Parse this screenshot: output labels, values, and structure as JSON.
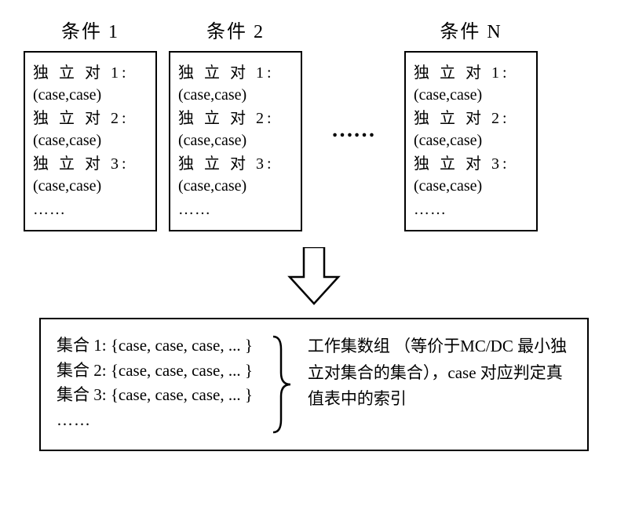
{
  "headers": {
    "condition1": "条件 1",
    "condition2": "条件 2",
    "conditionN": "条件 N"
  },
  "box_content": {
    "pair1_label": "独 立 对  1:",
    "pair1_value": "(case,case)",
    "pair2_label": "独 立 对  2:",
    "pair2_value": "(case,case)",
    "pair3_label": "独 立 对  3:",
    "pair3_value": "(case,case)",
    "ellipsis": "……"
  },
  "horizontal_ellipsis": "……",
  "bottom": {
    "set1": "集合 1: {case, case, case, ... }",
    "set2": "集合 2: {case, case, case, ... }",
    "set3": "集合 3: {case, case, case, ... }",
    "set_ellipsis": "……",
    "description": "工作集数组 （等价于MC/DC 最小独立对集合的集合），case 对应判定真值表中的索引"
  }
}
